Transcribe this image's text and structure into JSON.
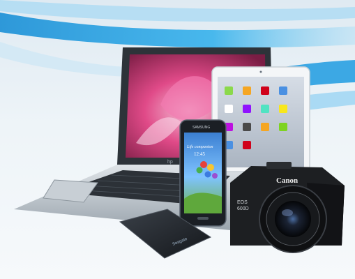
{
  "scene": {
    "laptop_brand_logo": "hp",
    "phone_brand": "SAMSUNG",
    "phone_wallpaper_text": "Life companion",
    "phone_clock": "12:45",
    "camera_brand": "Canon",
    "camera_model_line1": "EOS",
    "camera_model_line2": "600D",
    "hdd_logo": "Seagate",
    "colors": {
      "background": "#eef4f8",
      "swoosh": "#1d9be0",
      "swoosh_light": "#8fd0f2",
      "laptop_body": "#b9c2ca",
      "screen_pink": "#e34a86",
      "camera_black": "#1d1f22",
      "tablet_white": "#f4f6f8"
    }
  }
}
